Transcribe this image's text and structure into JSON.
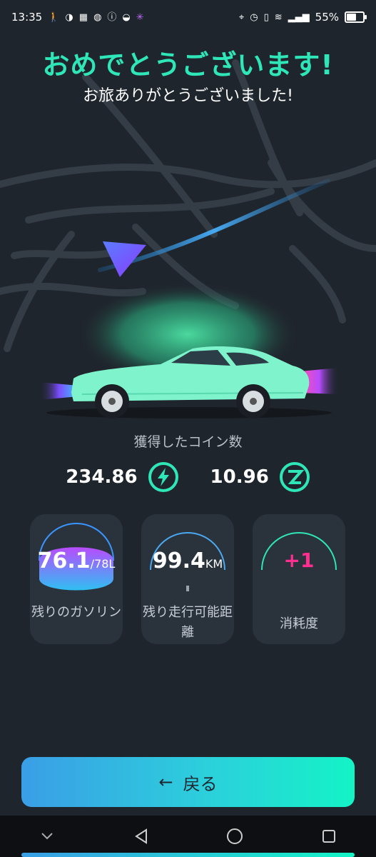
{
  "status_bar": {
    "time": "13:35",
    "battery_percent": "55%",
    "left_icons": [
      "walk-icon",
      "moon-icon",
      "news-icon",
      "app-icon",
      "info-icon",
      "bike-icon",
      "sparkle-icon"
    ],
    "right_icons": [
      "location-icon",
      "alarm-icon",
      "vibrate-icon",
      "wifi-icon",
      "signal-icon",
      "battery-icon"
    ]
  },
  "header": {
    "title": "おめでとうございます!",
    "subtitle": "お旅ありがとうございました!"
  },
  "coins": {
    "label": "獲得したコイン数",
    "energy_value": "234.86",
    "energy_icon": "lightning-coin-icon",
    "z_value": "10.96",
    "z_icon": "z-coin-icon"
  },
  "stats": [
    {
      "value": "76.1",
      "unit": "/78L",
      "label": "残りのガソリン",
      "fill_fraction": 0.976
    },
    {
      "value": "99.4",
      "unit": "KM",
      "label": "残り走行可能距離"
    },
    {
      "value": "+1",
      "label": "消耗度"
    }
  ],
  "actions": {
    "back_label": "戻る",
    "back_icon": "arrow-left-icon"
  },
  "nav": {
    "icons": [
      "chevron-down-icon",
      "back-triangle-icon",
      "home-circle-icon",
      "recents-square-icon"
    ]
  },
  "colors": {
    "accent": "#2ee6b8",
    "card_bg": "#2a323c",
    "car": "#7ff3cc",
    "wear": "#ff2f8f"
  }
}
